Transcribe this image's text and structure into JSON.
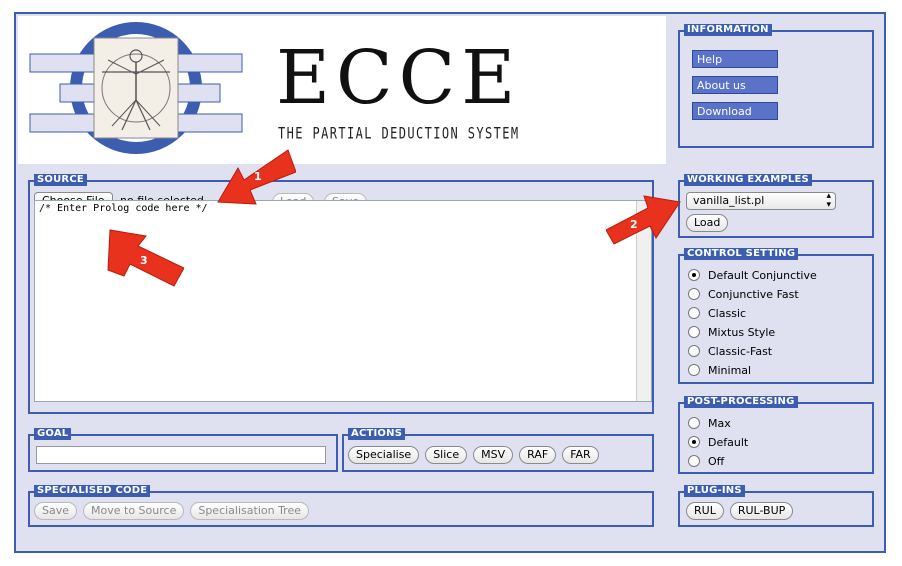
{
  "logo": {
    "title": "ECCE",
    "subtitle": "THE PARTIAL DEDUCTION SYSTEM",
    "image": "vitruvian-man-logo"
  },
  "information": {
    "legend": "INFORMATION",
    "buttons": [
      {
        "label": "Help"
      },
      {
        "label": "About us"
      },
      {
        "label": "Download"
      }
    ]
  },
  "source": {
    "legend": "SOURCE",
    "choose_file": "Choose File",
    "file_status": "no file selected",
    "load": "Load",
    "save": "Save",
    "code": "/* Enter Prolog code here */"
  },
  "working_examples": {
    "legend": "WORKING EXAMPLES",
    "selected": "vanilla_list.pl",
    "load": "Load"
  },
  "control_setting": {
    "legend": "CONTROL SETTING",
    "options": [
      {
        "label": "Default Conjunctive",
        "checked": true
      },
      {
        "label": "Conjunctive Fast",
        "checked": false
      },
      {
        "label": "Classic",
        "checked": false
      },
      {
        "label": "Mixtus Style",
        "checked": false
      },
      {
        "label": "Classic-Fast",
        "checked": false
      },
      {
        "label": "Minimal",
        "checked": false
      }
    ]
  },
  "goal": {
    "legend": "GOAL",
    "value": ""
  },
  "actions": {
    "legend": "ACTIONS",
    "buttons": [
      "Specialise",
      "Slice",
      "MSV",
      "RAF",
      "FAR"
    ]
  },
  "post_processing": {
    "legend": "POST-PROCESSING",
    "options": [
      {
        "label": "Max",
        "checked": false
      },
      {
        "label": "Default",
        "checked": true
      },
      {
        "label": "Off",
        "checked": false
      }
    ]
  },
  "specialised_code": {
    "legend": "SPECIALISED CODE",
    "buttons": [
      "Save",
      "Move to Source",
      "Specialisation Tree"
    ]
  },
  "plugins": {
    "legend": "PLUG-INS",
    "buttons": [
      "RUL",
      "RUL-BUP"
    ]
  },
  "annotations": {
    "arrow1": "1",
    "arrow2": "2",
    "arrow3": "3",
    "color": "#e8321e"
  }
}
